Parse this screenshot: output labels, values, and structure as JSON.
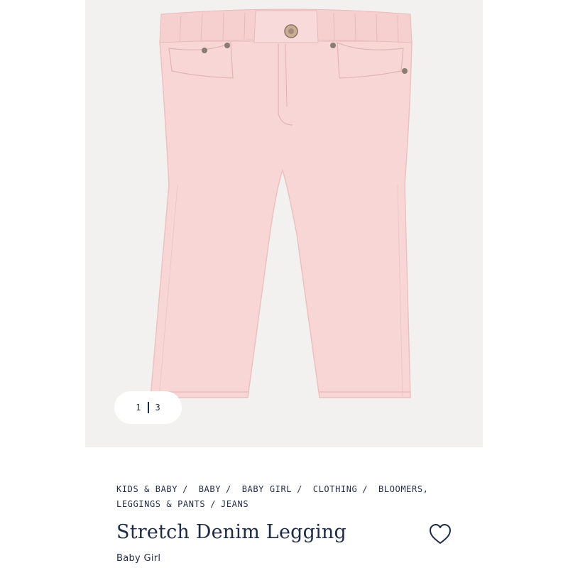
{
  "gallery": {
    "current": "1",
    "total": "3",
    "image_alt": "Stretch Denim Legging"
  },
  "breadcrumb": [
    "KIDS & BABY",
    "BABY",
    "BABY GIRL",
    "CLOTHING",
    "BLOOMERS, LEGGINGS & PANTS",
    "JEANS"
  ],
  "product": {
    "title": "Stretch Denim Legging",
    "subtitle": "Baby Girl",
    "color": "#f8d6d6"
  },
  "icons": {
    "wishlist": "heart-icon"
  },
  "colors": {
    "text": "#1f2a44",
    "background": "#f3f1ef"
  }
}
